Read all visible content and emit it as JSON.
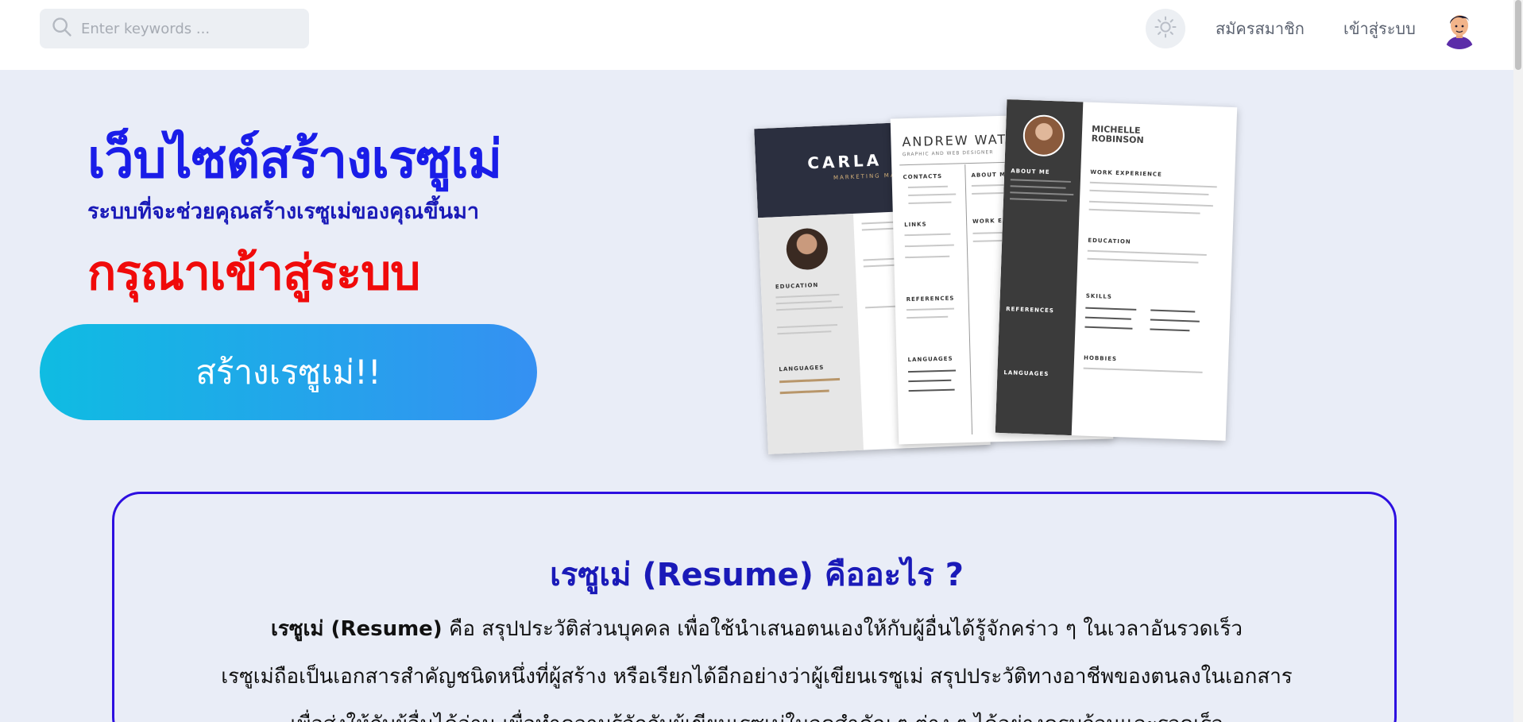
{
  "search": {
    "placeholder": "Enter keywords ..."
  },
  "nav": {
    "theme_icon": "sun-icon",
    "register_label": "สมัครสมาชิก",
    "login_label": "เข้าสู่ระบบ",
    "avatar_icon": "user-avatar"
  },
  "hero": {
    "title": "เว็บไซต์สร้างเรซูเม่",
    "subtitle": "ระบบที่จะช่วยคุณสร้างเรซูเม่ของคุณขึ้นมา",
    "login_prompt": "กรุณาเข้าสู่ระบบ",
    "cta_label": "สร้างเรซูเม่!!",
    "title_color": "#1a1de8",
    "login_color": "#f00a0a"
  },
  "resumes": {
    "carla_name": "CARLA MO",
    "carla_role": "MARKETING MAN",
    "andrew_name": "ANDREW WAT",
    "andrew_role": "GRAPHIC AND WEB DESIGNER",
    "michelle_name_1": "MICHELLE",
    "michelle_name_2": "ROBINSON",
    "education": "EDUCATION",
    "languages": "LANGUAGES",
    "contacts": "CONTACTS",
    "links": "LINKS",
    "references": "REFERENCES",
    "about_me": "ABOUT ME",
    "work_experience": "WORK EXPERIENCE",
    "skills": "SKILLS",
    "hobbies": "HOBBIES"
  },
  "info": {
    "title": "เรซูเม่ (Resume) คืออะไร ?",
    "bold_term": "เรซูเม่ (Resume)",
    "line1_rest": " คือ สรุปประวัติส่วนบุคคล เพื่อใช้นำเสนอตนเองให้กับผู้อื่นได้รู้จักคร่าว ๆ ในเวลาอันรวดเร็ว",
    "line2": "เรซูเม่ถือเป็นเอกสารสำคัญชนิดหนึ่งที่ผู้สร้าง หรือเรียกได้อีกอย่างว่าผู้เขียนเรซูเม่ สรุปประวัติทางอาชีพของตนลงในเอกสาร",
    "line3": "เพื่อส่งให้กับผู้อื่นได้อ่าน เพื่อทำความรู้จักกับผู้เขียนเรซูเม่ในจุดสำคัญ ๆ ต่าง ๆ ได้อย่างครบถ้วนและรวดเร็ว",
    "border_color": "#2d0fe0"
  }
}
